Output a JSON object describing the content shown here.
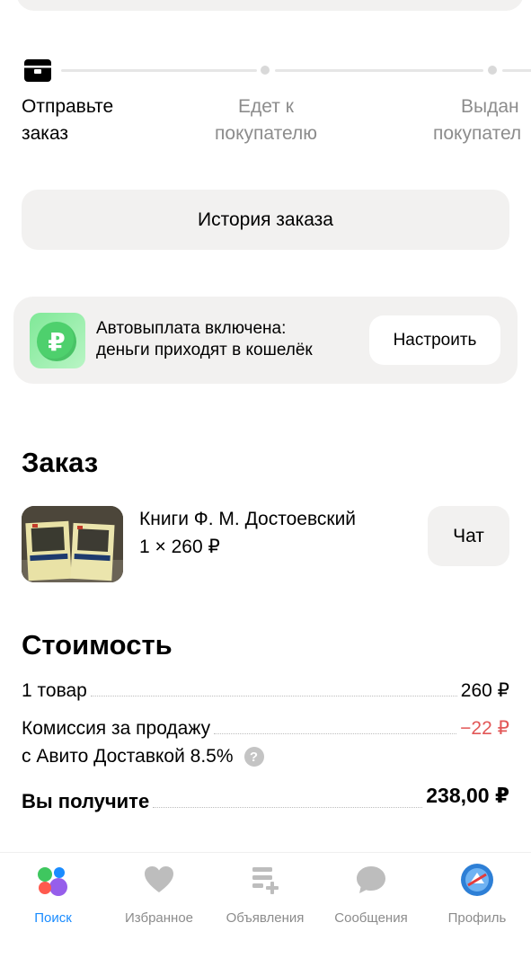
{
  "tracker": {
    "steps": [
      {
        "line1": "Отправьте",
        "line2": "заказ"
      },
      {
        "line1": "Едет к",
        "line2": "покупателю"
      },
      {
        "line1": "Выдан",
        "line2": "покупател"
      }
    ]
  },
  "history_button": "История заказа",
  "autopay": {
    "icon": "ruble-icon",
    "line1": "Автовыплата включена:",
    "line2": "деньги приходят в кошелёк",
    "button": "Настроить"
  },
  "order": {
    "title": "Заказ",
    "name": "Книги Ф. М. Достоевский",
    "qty": "1 × 260 ₽",
    "chat": "Чат"
  },
  "cost": {
    "title": "Стоимость",
    "rows": [
      {
        "label": "1 товар",
        "value": "260 ₽"
      },
      {
        "label": "Комиссия за продажу",
        "sublabel": "с Авито Доставкой 8.5%",
        "value": "−22 ₽"
      },
      {
        "label": "Вы получите",
        "value": "238,00 ₽"
      }
    ]
  },
  "tabbar": [
    {
      "label": "Поиск",
      "icon": "search-dots-icon",
      "active": true
    },
    {
      "label": "Избранное",
      "icon": "heart-icon"
    },
    {
      "label": "Объявления",
      "icon": "ads-add-icon"
    },
    {
      "label": "Сообщения",
      "icon": "chat-bubble-icon"
    },
    {
      "label": "Профиль",
      "icon": "avatar-icon"
    }
  ],
  "colors": {
    "accent_blue": "#1a8cff",
    "negative_red": "#e25757",
    "card_bg": "#f2f1f0",
    "green": "#4ed06d"
  }
}
